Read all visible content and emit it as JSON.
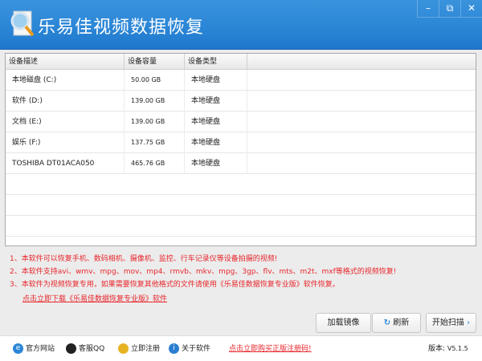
{
  "title": "乐易佳视频数据恢复",
  "window": {
    "minimize": "–",
    "restore": "⧉",
    "close": "✕"
  },
  "table": {
    "headers": [
      "设备描述",
      "设备容量",
      "设备类型"
    ],
    "rows": [
      [
        "本地磁盘 (C:)",
        "50.00 GB",
        "本地硬盘"
      ],
      [
        "软件 (D:)",
        "139.00 GB",
        "本地硬盘"
      ],
      [
        "文档 (E:)",
        "139.00 GB",
        "本地硬盘"
      ],
      [
        "娱乐 (F:)",
        "137.75 GB",
        "本地硬盘"
      ],
      [
        "TOSHIBA DT01ACA050",
        "465.76 GB",
        "本地硬盘"
      ]
    ]
  },
  "notes": [
    "1、本软件可以恢复手机、数码相机、摄像机、监控、行车记录仪等设备拍摄的视频!",
    "2、本软件支持avi、wmv、mpg、mov、mp4、rmvb、mkv、mpg、3gp、flv、mts、m2t、mxf等格式的视频恢复!",
    "3、本软件为视频恢复专用，如果需要恢复其他格式的文件请使用《乐易佳数据恢复专业版》软件恢复。"
  ],
  "download_link": "点击立即下载《乐易佳数据恢复专业版》软件",
  "buttons": {
    "load_image": "加载镜像",
    "refresh": "刷新",
    "start_scan": "开始扫描"
  },
  "footer": {
    "website": "官方网站",
    "qq": "客服QQ",
    "register": "立即注册",
    "about": "关于软件",
    "buy_link": "点击立即购买正版注册码!",
    "version_label": "版本:",
    "version": "V5.1.5"
  },
  "colors": {
    "titlebar": "#2a85d6",
    "notes": "#e8262b"
  }
}
